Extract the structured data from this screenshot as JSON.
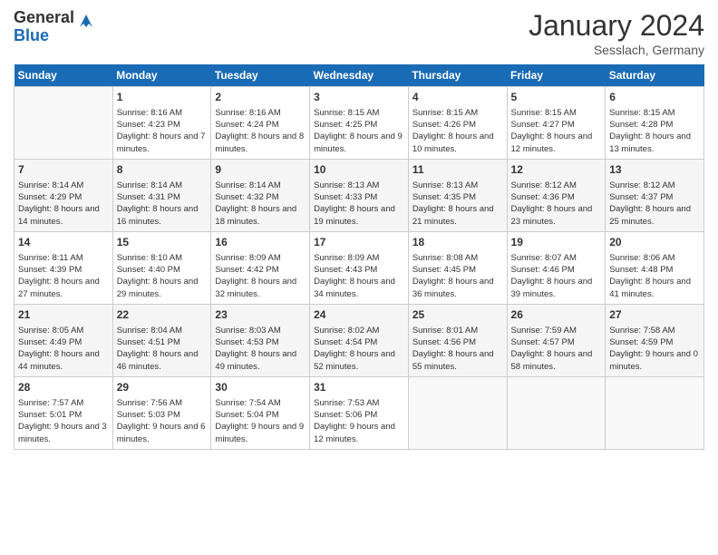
{
  "header": {
    "logo_general": "General",
    "logo_blue": "Blue",
    "month_title": "January 2024",
    "location": "Sesslach, Germany"
  },
  "days_of_week": [
    "Sunday",
    "Monday",
    "Tuesday",
    "Wednesday",
    "Thursday",
    "Friday",
    "Saturday"
  ],
  "weeks": [
    [
      {
        "day": "",
        "sunrise": "",
        "sunset": "",
        "daylight": "",
        "empty": true
      },
      {
        "day": "1",
        "sunrise": "Sunrise: 8:16 AM",
        "sunset": "Sunset: 4:23 PM",
        "daylight": "Daylight: 8 hours and 7 minutes."
      },
      {
        "day": "2",
        "sunrise": "Sunrise: 8:16 AM",
        "sunset": "Sunset: 4:24 PM",
        "daylight": "Daylight: 8 hours and 8 minutes."
      },
      {
        "day": "3",
        "sunrise": "Sunrise: 8:15 AM",
        "sunset": "Sunset: 4:25 PM",
        "daylight": "Daylight: 8 hours and 9 minutes."
      },
      {
        "day": "4",
        "sunrise": "Sunrise: 8:15 AM",
        "sunset": "Sunset: 4:26 PM",
        "daylight": "Daylight: 8 hours and 10 minutes."
      },
      {
        "day": "5",
        "sunrise": "Sunrise: 8:15 AM",
        "sunset": "Sunset: 4:27 PM",
        "daylight": "Daylight: 8 hours and 12 minutes."
      },
      {
        "day": "6",
        "sunrise": "Sunrise: 8:15 AM",
        "sunset": "Sunset: 4:28 PM",
        "daylight": "Daylight: 8 hours and 13 minutes."
      }
    ],
    [
      {
        "day": "7",
        "sunrise": "Sunrise: 8:14 AM",
        "sunset": "Sunset: 4:29 PM",
        "daylight": "Daylight: 8 hours and 14 minutes."
      },
      {
        "day": "8",
        "sunrise": "Sunrise: 8:14 AM",
        "sunset": "Sunset: 4:31 PM",
        "daylight": "Daylight: 8 hours and 16 minutes."
      },
      {
        "day": "9",
        "sunrise": "Sunrise: 8:14 AM",
        "sunset": "Sunset: 4:32 PM",
        "daylight": "Daylight: 8 hours and 18 minutes."
      },
      {
        "day": "10",
        "sunrise": "Sunrise: 8:13 AM",
        "sunset": "Sunset: 4:33 PM",
        "daylight": "Daylight: 8 hours and 19 minutes."
      },
      {
        "day": "11",
        "sunrise": "Sunrise: 8:13 AM",
        "sunset": "Sunset: 4:35 PM",
        "daylight": "Daylight: 8 hours and 21 minutes."
      },
      {
        "day": "12",
        "sunrise": "Sunrise: 8:12 AM",
        "sunset": "Sunset: 4:36 PM",
        "daylight": "Daylight: 8 hours and 23 minutes."
      },
      {
        "day": "13",
        "sunrise": "Sunrise: 8:12 AM",
        "sunset": "Sunset: 4:37 PM",
        "daylight": "Daylight: 8 hours and 25 minutes."
      }
    ],
    [
      {
        "day": "14",
        "sunrise": "Sunrise: 8:11 AM",
        "sunset": "Sunset: 4:39 PM",
        "daylight": "Daylight: 8 hours and 27 minutes."
      },
      {
        "day": "15",
        "sunrise": "Sunrise: 8:10 AM",
        "sunset": "Sunset: 4:40 PM",
        "daylight": "Daylight: 8 hours and 29 minutes."
      },
      {
        "day": "16",
        "sunrise": "Sunrise: 8:09 AM",
        "sunset": "Sunset: 4:42 PM",
        "daylight": "Daylight: 8 hours and 32 minutes."
      },
      {
        "day": "17",
        "sunrise": "Sunrise: 8:09 AM",
        "sunset": "Sunset: 4:43 PM",
        "daylight": "Daylight: 8 hours and 34 minutes."
      },
      {
        "day": "18",
        "sunrise": "Sunrise: 8:08 AM",
        "sunset": "Sunset: 4:45 PM",
        "daylight": "Daylight: 8 hours and 36 minutes."
      },
      {
        "day": "19",
        "sunrise": "Sunrise: 8:07 AM",
        "sunset": "Sunset: 4:46 PM",
        "daylight": "Daylight: 8 hours and 39 minutes."
      },
      {
        "day": "20",
        "sunrise": "Sunrise: 8:06 AM",
        "sunset": "Sunset: 4:48 PM",
        "daylight": "Daylight: 8 hours and 41 minutes."
      }
    ],
    [
      {
        "day": "21",
        "sunrise": "Sunrise: 8:05 AM",
        "sunset": "Sunset: 4:49 PM",
        "daylight": "Daylight: 8 hours and 44 minutes."
      },
      {
        "day": "22",
        "sunrise": "Sunrise: 8:04 AM",
        "sunset": "Sunset: 4:51 PM",
        "daylight": "Daylight: 8 hours and 46 minutes."
      },
      {
        "day": "23",
        "sunrise": "Sunrise: 8:03 AM",
        "sunset": "Sunset: 4:53 PM",
        "daylight": "Daylight: 8 hours and 49 minutes."
      },
      {
        "day": "24",
        "sunrise": "Sunrise: 8:02 AM",
        "sunset": "Sunset: 4:54 PM",
        "daylight": "Daylight: 8 hours and 52 minutes."
      },
      {
        "day": "25",
        "sunrise": "Sunrise: 8:01 AM",
        "sunset": "Sunset: 4:56 PM",
        "daylight": "Daylight: 8 hours and 55 minutes."
      },
      {
        "day": "26",
        "sunrise": "Sunrise: 7:59 AM",
        "sunset": "Sunset: 4:57 PM",
        "daylight": "Daylight: 8 hours and 58 minutes."
      },
      {
        "day": "27",
        "sunrise": "Sunrise: 7:58 AM",
        "sunset": "Sunset: 4:59 PM",
        "daylight": "Daylight: 9 hours and 0 minutes."
      }
    ],
    [
      {
        "day": "28",
        "sunrise": "Sunrise: 7:57 AM",
        "sunset": "Sunset: 5:01 PM",
        "daylight": "Daylight: 9 hours and 3 minutes."
      },
      {
        "day": "29",
        "sunrise": "Sunrise: 7:56 AM",
        "sunset": "Sunset: 5:03 PM",
        "daylight": "Daylight: 9 hours and 6 minutes."
      },
      {
        "day": "30",
        "sunrise": "Sunrise: 7:54 AM",
        "sunset": "Sunset: 5:04 PM",
        "daylight": "Daylight: 9 hours and 9 minutes."
      },
      {
        "day": "31",
        "sunrise": "Sunrise: 7:53 AM",
        "sunset": "Sunset: 5:06 PM",
        "daylight": "Daylight: 9 hours and 12 minutes."
      },
      {
        "day": "",
        "sunrise": "",
        "sunset": "",
        "daylight": "",
        "empty": true
      },
      {
        "day": "",
        "sunrise": "",
        "sunset": "",
        "daylight": "",
        "empty": true
      },
      {
        "day": "",
        "sunrise": "",
        "sunset": "",
        "daylight": "",
        "empty": true
      }
    ]
  ]
}
